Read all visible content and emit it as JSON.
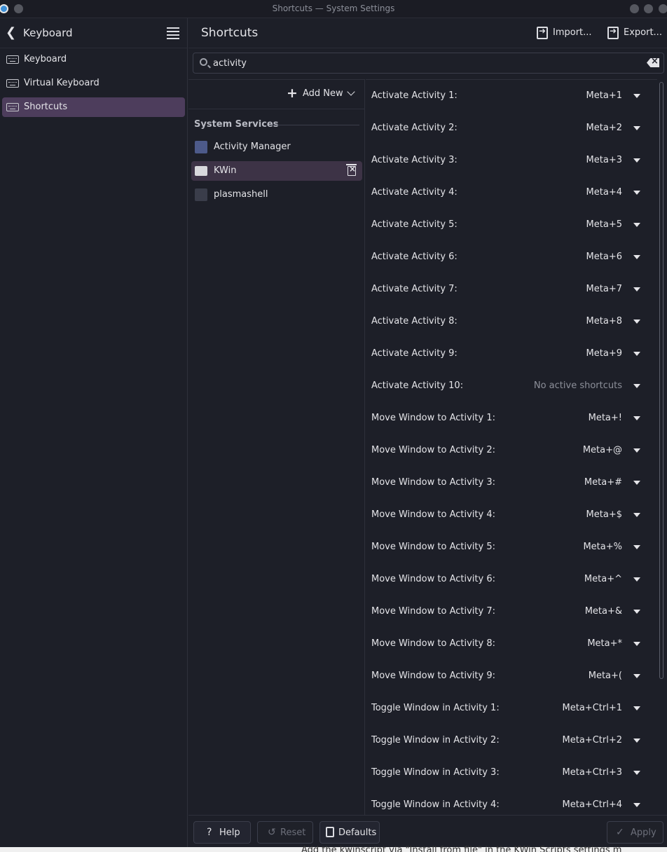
{
  "window": {
    "title": "Shortcuts — System Settings"
  },
  "sidebar": {
    "back_label": "Keyboard",
    "items": [
      {
        "label": "Keyboard",
        "icon": "keyboard-icon"
      },
      {
        "label": "Virtual Keyboard",
        "icon": "keyboard-icon"
      },
      {
        "label": "Shortcuts",
        "icon": "keyboard-icon",
        "active": true
      }
    ]
  },
  "header": {
    "title": "Shortcuts",
    "import_label": "Import...",
    "export_label": "Export..."
  },
  "search": {
    "value": "activity"
  },
  "components": {
    "add_new_label": "Add New",
    "section_label": "System Services",
    "items": [
      {
        "label": "Activity Manager",
        "icon": "activity-manager-icon"
      },
      {
        "label": "KWin",
        "icon": "kwin-icon",
        "selected": true
      },
      {
        "label": "plasmashell",
        "icon": "plasmashell-icon"
      }
    ]
  },
  "shortcuts": [
    {
      "name": "Activate Activity 1:",
      "keys": "Meta+1"
    },
    {
      "name": "Activate Activity 2:",
      "keys": "Meta+2"
    },
    {
      "name": "Activate Activity 3:",
      "keys": "Meta+3"
    },
    {
      "name": "Activate Activity 4:",
      "keys": "Meta+4"
    },
    {
      "name": "Activate Activity 5:",
      "keys": "Meta+5"
    },
    {
      "name": "Activate Activity 6:",
      "keys": "Meta+6"
    },
    {
      "name": "Activate Activity 7:",
      "keys": "Meta+7"
    },
    {
      "name": "Activate Activity 8:",
      "keys": "Meta+8"
    },
    {
      "name": "Activate Activity 9:",
      "keys": "Meta+9"
    },
    {
      "name": "Activate Activity 10:",
      "keys": "No active shortcuts",
      "none": true
    },
    {
      "name": "Move Window to Activity 1:",
      "keys": "Meta+!"
    },
    {
      "name": "Move Window to Activity 2:",
      "keys": "Meta+@"
    },
    {
      "name": "Move Window to Activity 3:",
      "keys": "Meta+#"
    },
    {
      "name": "Move Window to Activity 4:",
      "keys": "Meta+$"
    },
    {
      "name": "Move Window to Activity 5:",
      "keys": "Meta+%"
    },
    {
      "name": "Move Window to Activity 6:",
      "keys": "Meta+^"
    },
    {
      "name": "Move Window to Activity 7:",
      "keys": "Meta+&"
    },
    {
      "name": "Move Window to Activity 8:",
      "keys": "Meta+*"
    },
    {
      "name": "Move Window to Activity 9:",
      "keys": "Meta+("
    },
    {
      "name": "Toggle Window in Activity 1:",
      "keys": "Meta+Ctrl+1"
    },
    {
      "name": "Toggle Window in Activity 2:",
      "keys": "Meta+Ctrl+2"
    },
    {
      "name": "Toggle Window in Activity 3:",
      "keys": "Meta+Ctrl+3"
    },
    {
      "name": "Toggle Window in Activity 4:",
      "keys": "Meta+Ctrl+4"
    }
  ],
  "footer": {
    "help_label": "Help",
    "reset_label": "Reset",
    "defaults_label": "Defaults",
    "apply_label": "Apply"
  },
  "background_text": "Add the kwinscript via \"Install from file\" in the KWin Scripts settings m"
}
